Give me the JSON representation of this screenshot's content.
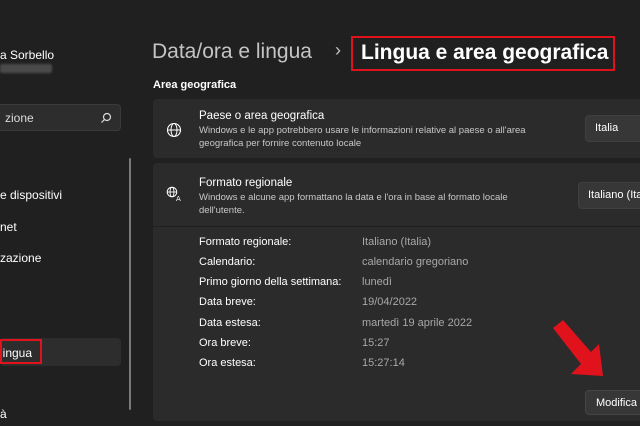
{
  "sidebar": {
    "user_name": "a Sorbello",
    "search_placeholder": "zione",
    "items": [
      {
        "label": "e dispositivi"
      },
      {
        "label": "net"
      },
      {
        "label": "zazione"
      },
      {
        "label": "lingua"
      },
      {
        "label": "à"
      }
    ]
  },
  "header": {
    "breadcrumb_parent": "Data/ora e lingua",
    "separator": "›",
    "breadcrumb_current": "Lingua e area geografica"
  },
  "section": {
    "title": "Area geografica"
  },
  "country": {
    "title": "Paese o area geografica",
    "description": "Windows e le app potrebbero usare le informazioni relative al paese o all'area geografica per fornire contenuto locale",
    "value": "Italia"
  },
  "regional_format": {
    "title": "Formato regionale",
    "description": "Windows e alcune app formattano la data e l'ora in base al formato locale dell'utente.",
    "value": "Italiano (Ita",
    "details": [
      {
        "label": "Formato regionale:",
        "value": "Italiano (Italia)"
      },
      {
        "label": "Calendario:",
        "value": "calendario gregoriano"
      },
      {
        "label": "Primo giorno della settimana:",
        "value": "lunedì"
      },
      {
        "label": "Data breve:",
        "value": "19/04/2022"
      },
      {
        "label": "Data estesa:",
        "value": "martedì 19 aprile 2022"
      },
      {
        "label": "Ora breve:",
        "value": "15:27"
      },
      {
        "label": "Ora estesa:",
        "value": "15:27:14"
      }
    ],
    "modify_button": "Modifica"
  },
  "colors": {
    "background": "#202020",
    "card": "#2b2b2b",
    "highlight_red": "#e0121b"
  }
}
